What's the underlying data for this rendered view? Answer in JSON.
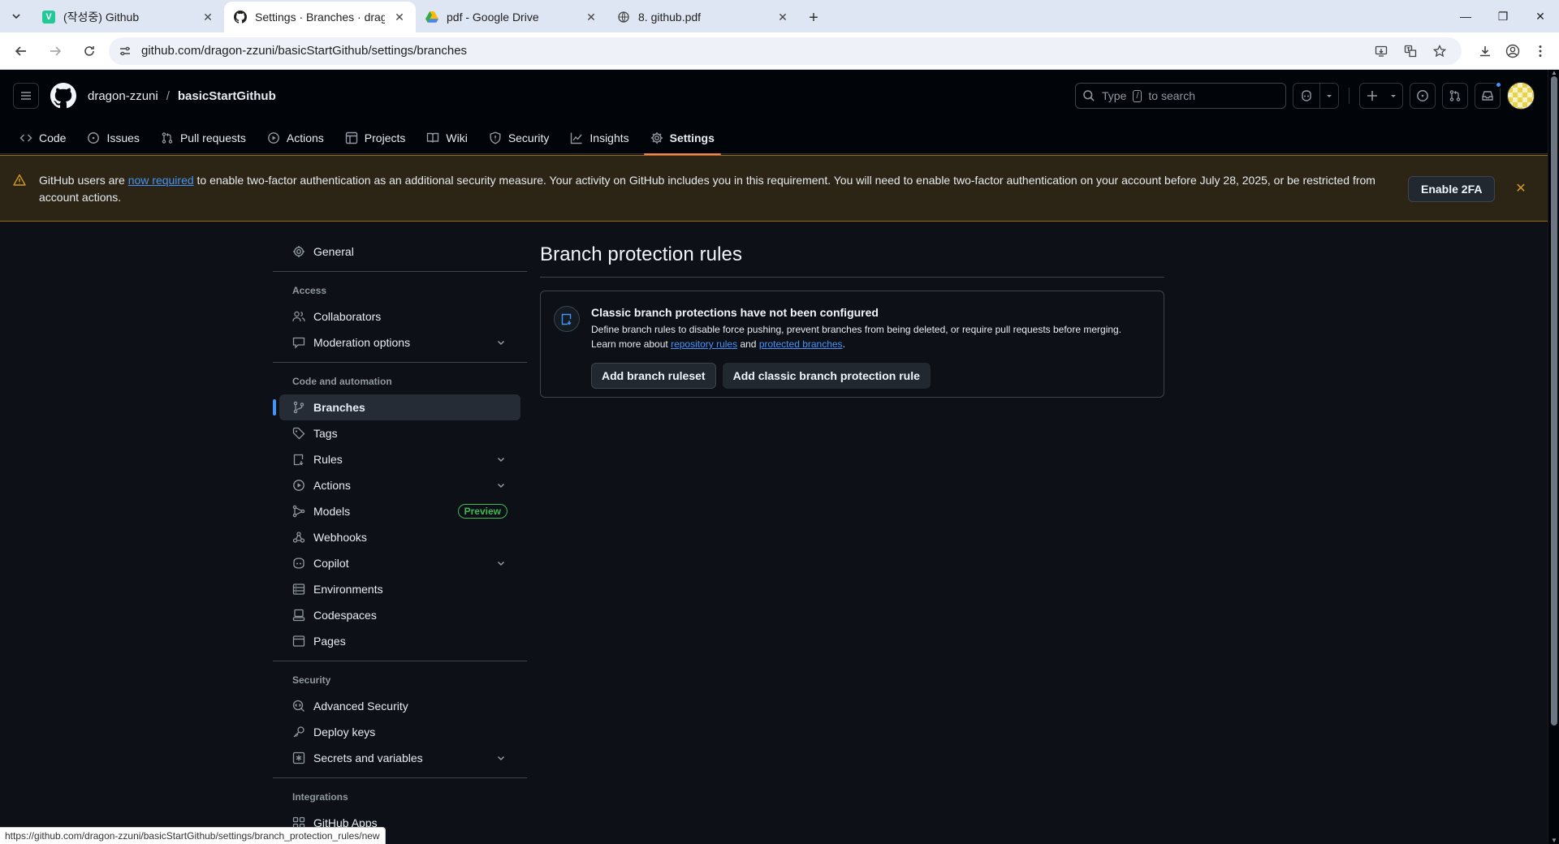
{
  "browser": {
    "tabs": [
      {
        "title": "(작성중) Github",
        "favicon": "V",
        "favicon_color": "#20c997",
        "active": false
      },
      {
        "title": "Settings · Branches · dragon-zzuni/basicStartGithub",
        "favicon": "github",
        "active": true
      },
      {
        "title": "pdf - Google Drive",
        "favicon": "drive",
        "active": false
      },
      {
        "title": "8. github.pdf",
        "favicon": "globe",
        "active": false
      }
    ],
    "url": "github.com/dragon-zzuni/basicStartGithub/settings/branches",
    "status_url": "https://github.com/dragon-zzuni/basicStartGithub/settings/branch_protection_rules/new"
  },
  "header": {
    "owner": "dragon-zzuni",
    "slash": "/",
    "repo": "basicStartGithub",
    "search_prefix": "Type",
    "search_key": "/",
    "search_suffix": "to search"
  },
  "repo_nav": [
    {
      "label": "Code",
      "icon": "code-icon"
    },
    {
      "label": "Issues",
      "icon": "issue-icon"
    },
    {
      "label": "Pull requests",
      "icon": "pull-request-icon"
    },
    {
      "label": "Actions",
      "icon": "play-icon"
    },
    {
      "label": "Projects",
      "icon": "table-icon"
    },
    {
      "label": "Wiki",
      "icon": "book-icon"
    },
    {
      "label": "Security",
      "icon": "shield-icon"
    },
    {
      "label": "Insights",
      "icon": "graph-icon"
    },
    {
      "label": "Settings",
      "icon": "gear-icon",
      "active": true
    }
  ],
  "banner": {
    "text_before": "GitHub users are",
    "link": "now required",
    "text_after": "to enable two-factor authentication as an additional security measure. Your activity on GitHub includes you in this requirement. You will need to enable two-factor authentication on your account before July 28, 2025, or be restricted from account actions.",
    "button": "Enable 2FA"
  },
  "sidebar": {
    "general": "General",
    "sections": [
      {
        "heading": "Access",
        "items": [
          {
            "label": "Collaborators",
            "icon": "people-icon"
          },
          {
            "label": "Moderation options",
            "icon": "comment-icon",
            "expandable": true
          }
        ]
      },
      {
        "heading": "Code and automation",
        "items": [
          {
            "label": "Branches",
            "icon": "branch-icon",
            "active": true
          },
          {
            "label": "Tags",
            "icon": "tag-icon"
          },
          {
            "label": "Rules",
            "icon": "rules-icon",
            "expandable": true
          },
          {
            "label": "Actions",
            "icon": "play-icon",
            "expandable": true
          },
          {
            "label": "Models",
            "icon": "models-icon",
            "badge": "Preview"
          },
          {
            "label": "Webhooks",
            "icon": "webhook-icon"
          },
          {
            "label": "Copilot",
            "icon": "copilot-icon",
            "expandable": true
          },
          {
            "label": "Environments",
            "icon": "server-icon"
          },
          {
            "label": "Codespaces",
            "icon": "codespaces-icon"
          },
          {
            "label": "Pages",
            "icon": "browser-icon"
          }
        ]
      },
      {
        "heading": "Security",
        "items": [
          {
            "label": "Advanced Security",
            "icon": "codescan-icon"
          },
          {
            "label": "Deploy keys",
            "icon": "key-icon"
          },
          {
            "label": "Secrets and variables",
            "icon": "asterisk-icon",
            "expandable": true
          }
        ]
      },
      {
        "heading": "Integrations",
        "items": [
          {
            "label": "GitHub Apps",
            "icon": "apps-icon"
          }
        ]
      }
    ]
  },
  "main": {
    "title": "Branch protection rules",
    "card_title": "Classic branch protections have not been configured",
    "card_desc": "Define branch rules to disable force pushing, prevent branches from being deleted, or require pull requests before merging.",
    "learn_prefix": "Learn more about",
    "link1": "repository rules",
    "and": "and",
    "link2": "protected branches",
    "period": ".",
    "btn_ruleset": "Add branch ruleset",
    "btn_classic": "Add classic branch protection rule"
  }
}
